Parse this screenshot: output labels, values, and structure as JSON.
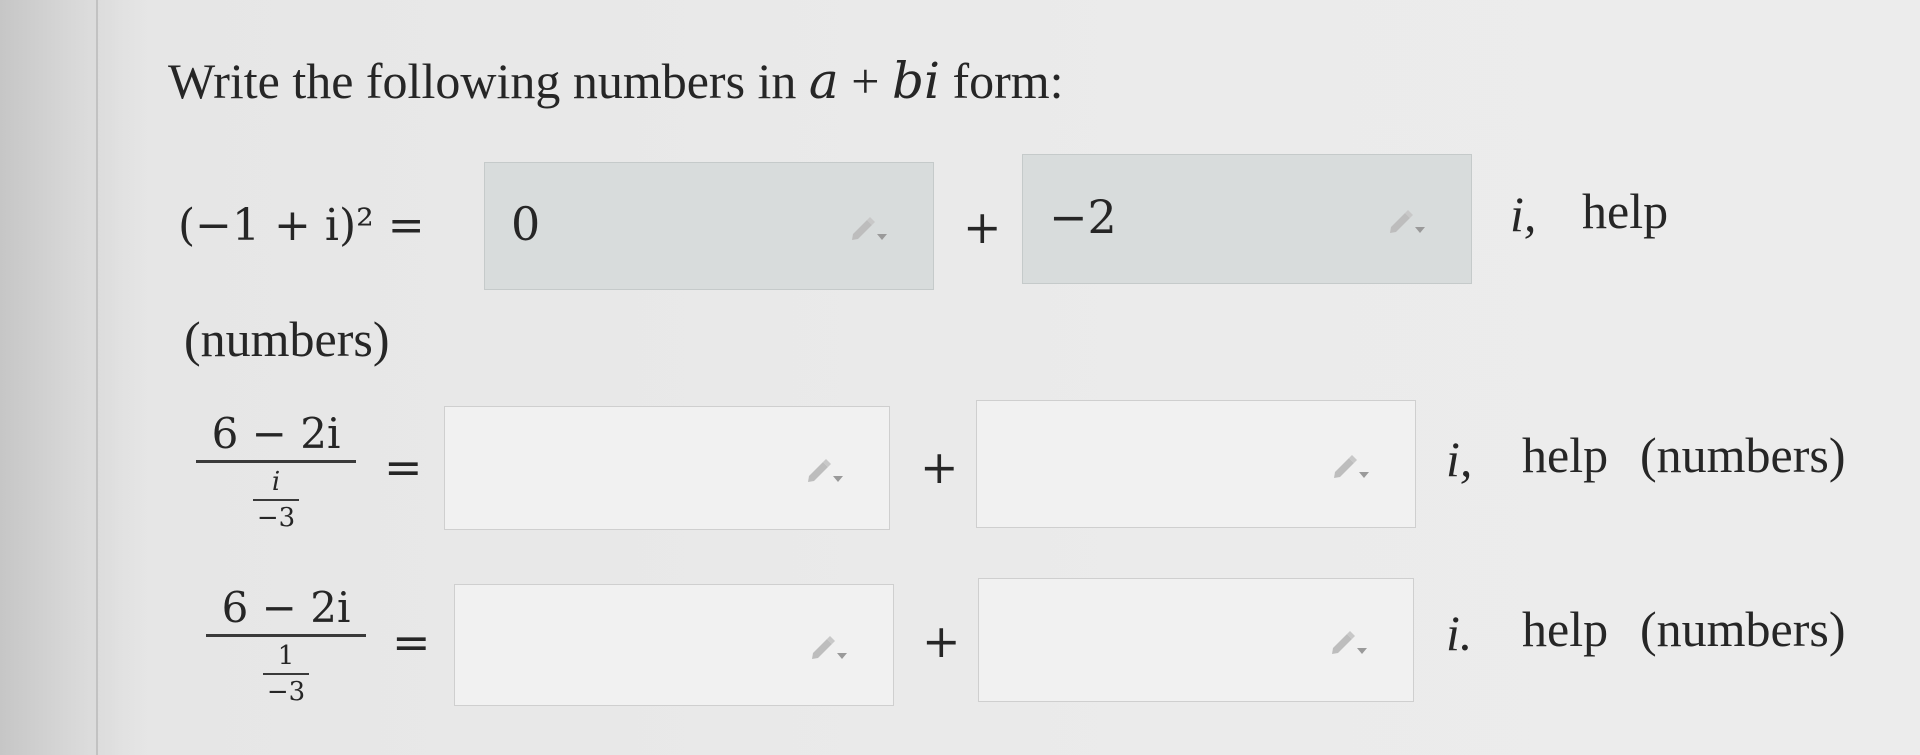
{
  "instructions": {
    "prefix": "Write the following numbers in ",
    "a": "a",
    "plus": " + ",
    "bi": "bi",
    "suffix": " form:"
  },
  "problems": [
    {
      "expression": "(−1 + i)² =",
      "real_value": "0",
      "imag_value": "−2",
      "plus": "+",
      "suffix": "i,",
      "help": "help",
      "numbers": "(numbers)"
    },
    {
      "numerator": "6 − 2i",
      "inner_numerator": "i",
      "inner_denominator": "−3",
      "equals": "=",
      "real_value": "",
      "imag_value": "",
      "plus": "+",
      "suffix": "i,",
      "help": "help",
      "numbers": "(numbers)"
    },
    {
      "numerator": "6 − 2i",
      "inner_numerator": "1",
      "inner_denominator": "−3",
      "equals": "=",
      "real_value": "",
      "imag_value": "",
      "plus": "+",
      "suffix": "i.",
      "help": "help",
      "numbers": "(numbers)"
    }
  ],
  "icons": {
    "edit": "pencil-dropdown-icon"
  }
}
